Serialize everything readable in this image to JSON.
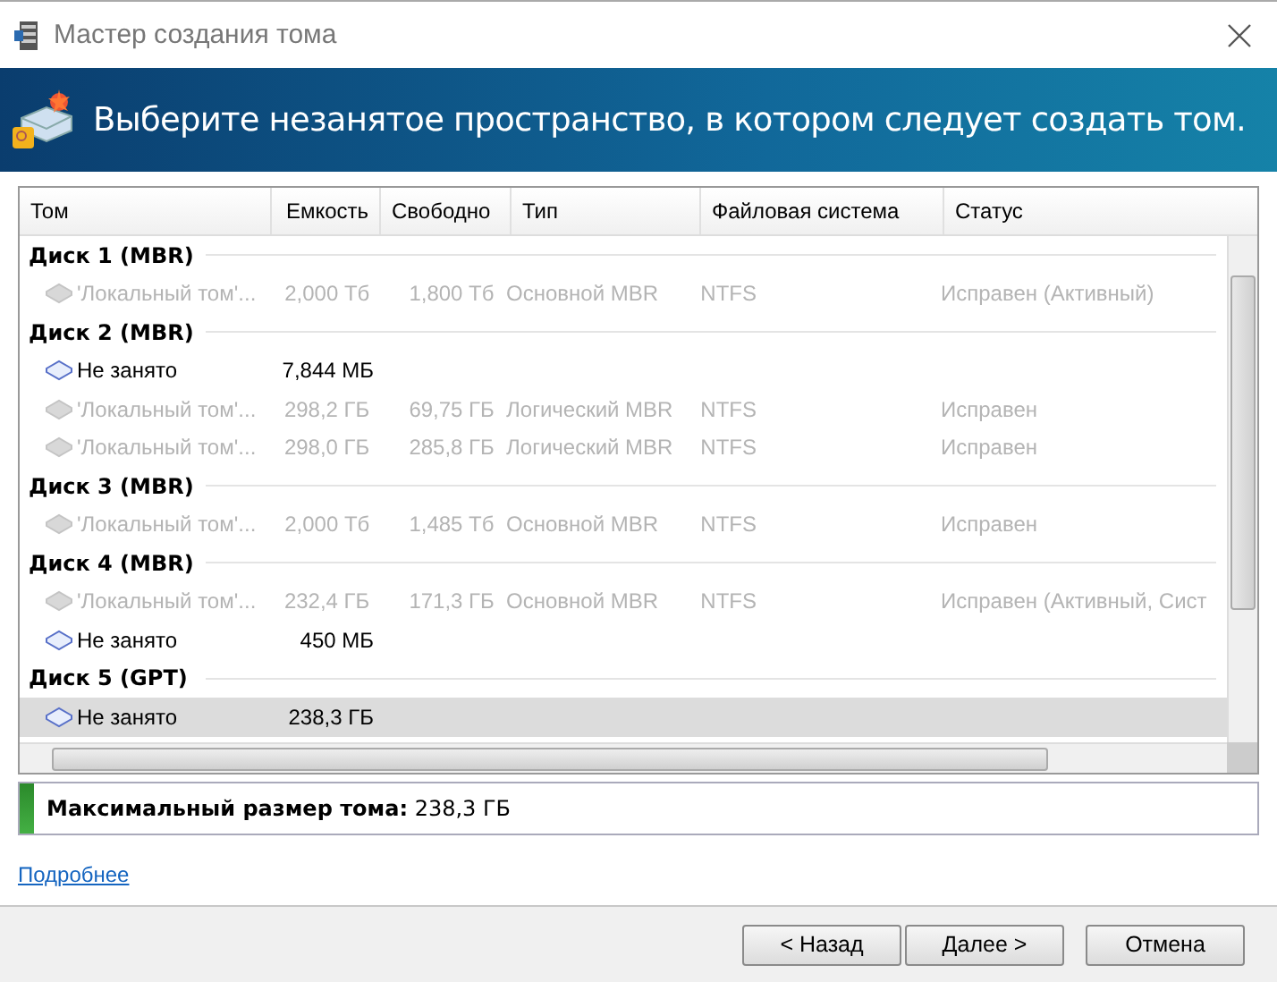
{
  "window": {
    "title": "Мастер создания тома"
  },
  "banner": {
    "text": "Выберите незанятое пространство, в котором следует создать том."
  },
  "table": {
    "columns": [
      "Том",
      "Емкость",
      "Свободно",
      "Тип",
      "Файловая система",
      "Статус"
    ],
    "rows": [
      {
        "kind": "header",
        "title": "Диск 1 (MBR)",
        "selected": false
      },
      {
        "kind": "volume",
        "disabled": true,
        "selected": false,
        "cells": [
          "'Локальный том'...",
          "2,000 Тб",
          "1,800 Тб",
          "Основной MBR",
          "NTFS",
          "Исправен (Активный)"
        ]
      },
      {
        "kind": "header",
        "title": "Диск 2 (MBR)",
        "selected": false
      },
      {
        "kind": "free",
        "disabled": false,
        "selected": false,
        "cells": [
          "Не занято",
          "7,844 МБ"
        ]
      },
      {
        "kind": "volume",
        "disabled": true,
        "selected": false,
        "cells": [
          "'Локальный том'...",
          "298,2 ГБ",
          "69,75 ГБ",
          "Логический MBR",
          "NTFS",
          "Исправен"
        ]
      },
      {
        "kind": "volume",
        "disabled": true,
        "selected": false,
        "cells": [
          "'Локальный том'...",
          "298,0 ГБ",
          "285,8 ГБ",
          "Логический MBR",
          "NTFS",
          "Исправен"
        ]
      },
      {
        "kind": "header",
        "title": "Диск 3 (MBR)",
        "selected": false
      },
      {
        "kind": "volume",
        "disabled": true,
        "selected": false,
        "cells": [
          "'Локальный том'...",
          "2,000 Тб",
          "1,485 Тб",
          "Основной MBR",
          "NTFS",
          "Исправен"
        ]
      },
      {
        "kind": "header",
        "title": "Диск 4 (MBR)",
        "selected": false
      },
      {
        "kind": "volume",
        "disabled": true,
        "selected": false,
        "cells": [
          "'Локальный том'...",
          "232,4 ГБ",
          "171,3 ГБ",
          "Основной MBR",
          "NTFS",
          "Исправен (Активный, Сист"
        ]
      },
      {
        "kind": "free",
        "disabled": false,
        "selected": false,
        "cells": [
          "Не занято",
          "450 МБ"
        ]
      },
      {
        "kind": "header",
        "title": "Диск 5 (GPT)",
        "selected": false
      },
      {
        "kind": "free",
        "disabled": false,
        "selected": true,
        "cells": [
          "Не занято",
          "238,3 ГБ"
        ]
      }
    ]
  },
  "summary": {
    "label": "Максимальный размер тома:",
    "value": "238,3 ГБ"
  },
  "link": "Подробнее",
  "buttons": [
    "< Назад",
    "Далее >",
    "Отмена"
  ]
}
